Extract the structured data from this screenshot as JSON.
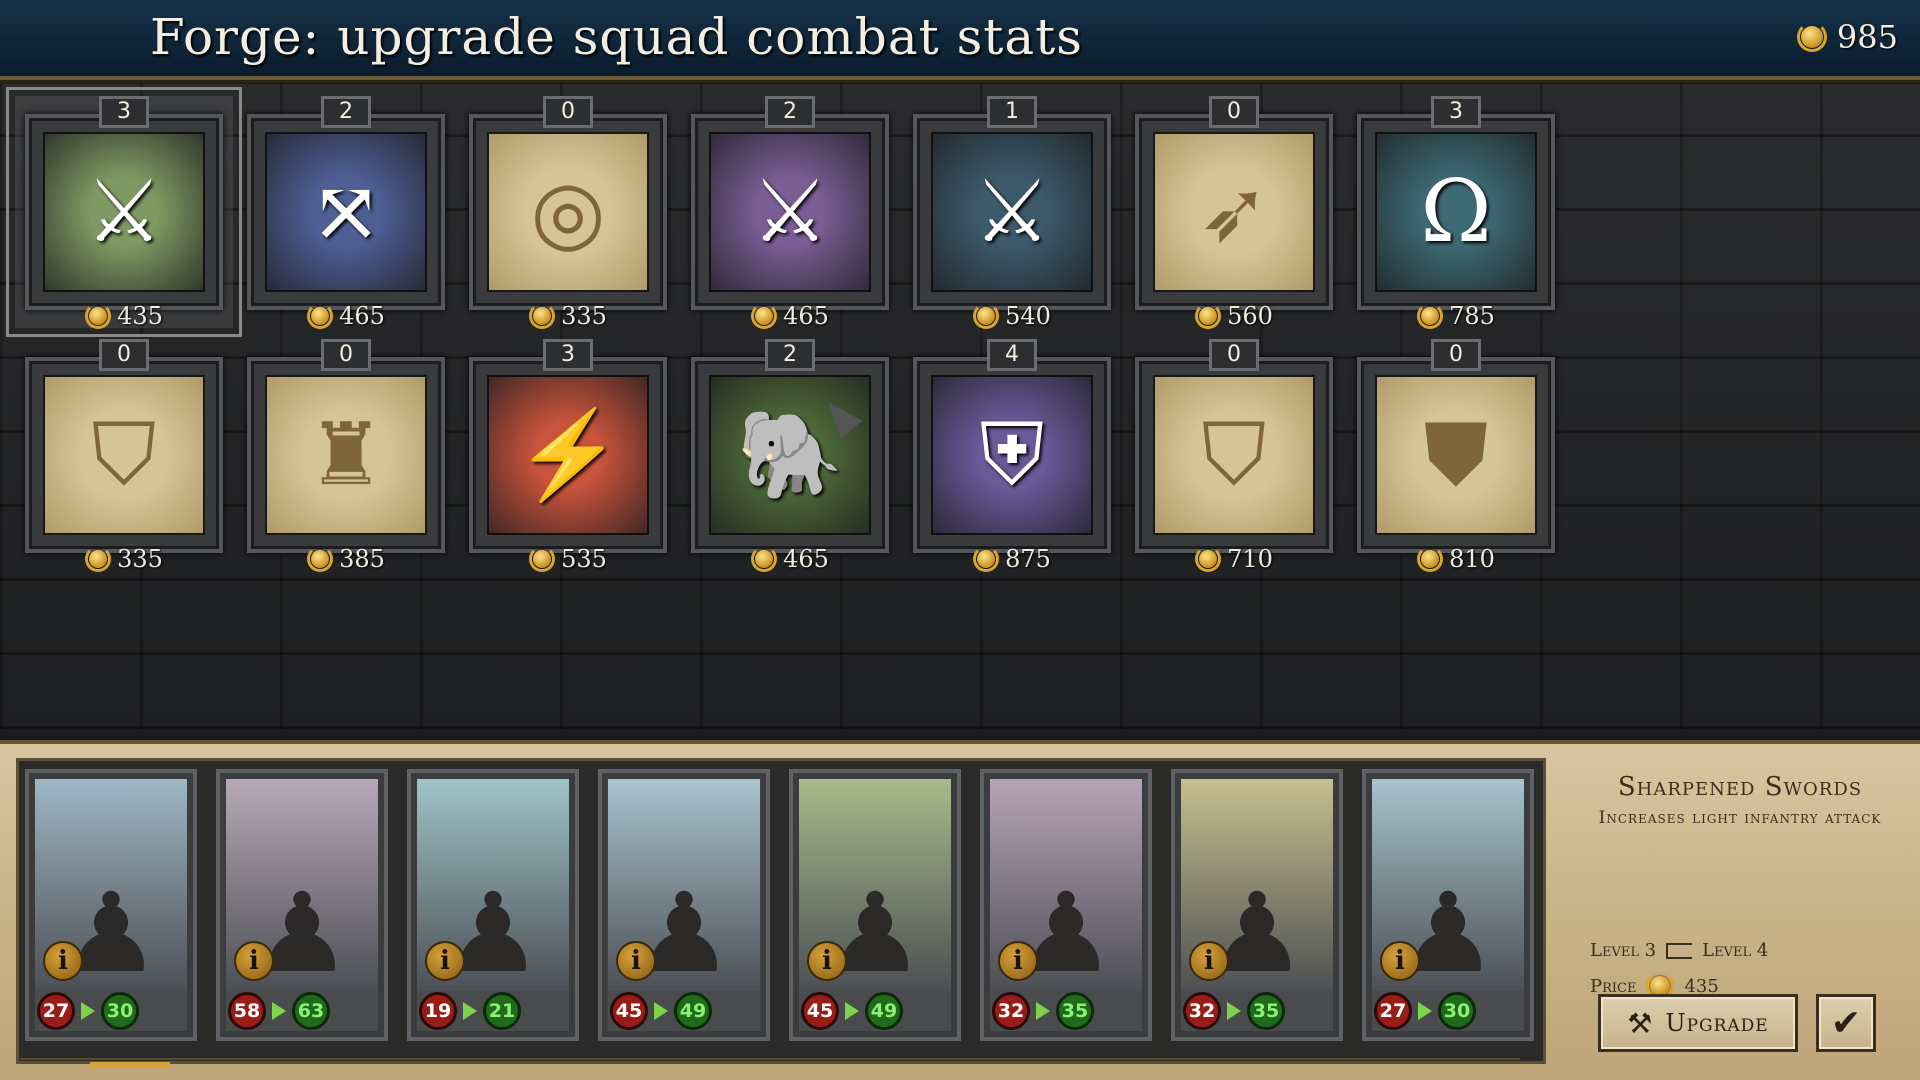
{
  "header": {
    "title": "Forge: upgrade squad combat stats",
    "gold": "985",
    "gold_icon": "laurel-coin-icon"
  },
  "upgrades": [
    {
      "level": "3",
      "price": "435",
      "icon": "sword",
      "unlocked": true,
      "color": "#7e9a62",
      "selected": true
    },
    {
      "level": "2",
      "price": "465",
      "icon": "crossed-arrows-horseshoe",
      "unlocked": true,
      "color": "#4f5f96"
    },
    {
      "level": "0",
      "price": "335",
      "icon": "archery-target",
      "unlocked": false,
      "color": "#e3cf93"
    },
    {
      "level": "2",
      "price": "465",
      "icon": "sword-horseshoe",
      "unlocked": true,
      "color": "#7b5d95"
    },
    {
      "level": "1",
      "price": "540",
      "icon": "three-swords",
      "unlocked": true,
      "color": "#3d5a6b"
    },
    {
      "level": "0",
      "price": "560",
      "icon": "three-arrows",
      "unlocked": false,
      "color": "#e3cf93"
    },
    {
      "level": "3",
      "price": "785",
      "icon": "horseshoe-broken-sword",
      "unlocked": true,
      "color": "#3d6a74"
    },
    {
      "level": "0",
      "price": "335",
      "icon": "shield",
      "unlocked": false,
      "color": "#e3cf93"
    },
    {
      "level": "0",
      "price": "385",
      "icon": "armor",
      "unlocked": false,
      "color": "#e3cf93"
    },
    {
      "level": "3",
      "price": "535",
      "icon": "lightning-sword",
      "unlocked": true,
      "color": "#c9533b"
    },
    {
      "level": "2",
      "price": "465",
      "icon": "elephant",
      "unlocked": true,
      "color": "#4e6a38"
    },
    {
      "level": "4",
      "price": "875",
      "icon": "sword-round-shield",
      "unlocked": true,
      "color": "#6a5a9a"
    },
    {
      "level": "0",
      "price": "710",
      "icon": "shield-arrow",
      "unlocked": false,
      "color": "#e3cf93"
    },
    {
      "level": "0",
      "price": "810",
      "icon": "horseshoe-shield",
      "unlocked": false,
      "color": "#e3cf93"
    }
  ],
  "units": [
    {
      "from": "27",
      "to": "30",
      "bg": "#9fb6c4"
    },
    {
      "from": "58",
      "to": "63",
      "bg": "#b7a8b8"
    },
    {
      "from": "19",
      "to": "21",
      "bg": "#9ec3c8"
    },
    {
      "from": "45",
      "to": "49",
      "bg": "#a9c3cf"
    },
    {
      "from": "45",
      "to": "49",
      "bg": "#a9b98a"
    },
    {
      "from": "32",
      "to": "35",
      "bg": "#b8a3b6"
    },
    {
      "from": "32",
      "to": "35",
      "bg": "#c7bf8d"
    },
    {
      "from": "27",
      "to": "30",
      "bg": "#a6c3cc"
    }
  ],
  "details": {
    "name": "Sharpened Swords",
    "description": "Increases light infantry attack",
    "level_from": "Level 3",
    "level_to": "Level 4",
    "price_label": "Price",
    "price_value": "435",
    "upgrade_label": "Upgrade",
    "confirm_icon": "checkmark-icon"
  },
  "info_label": "i"
}
